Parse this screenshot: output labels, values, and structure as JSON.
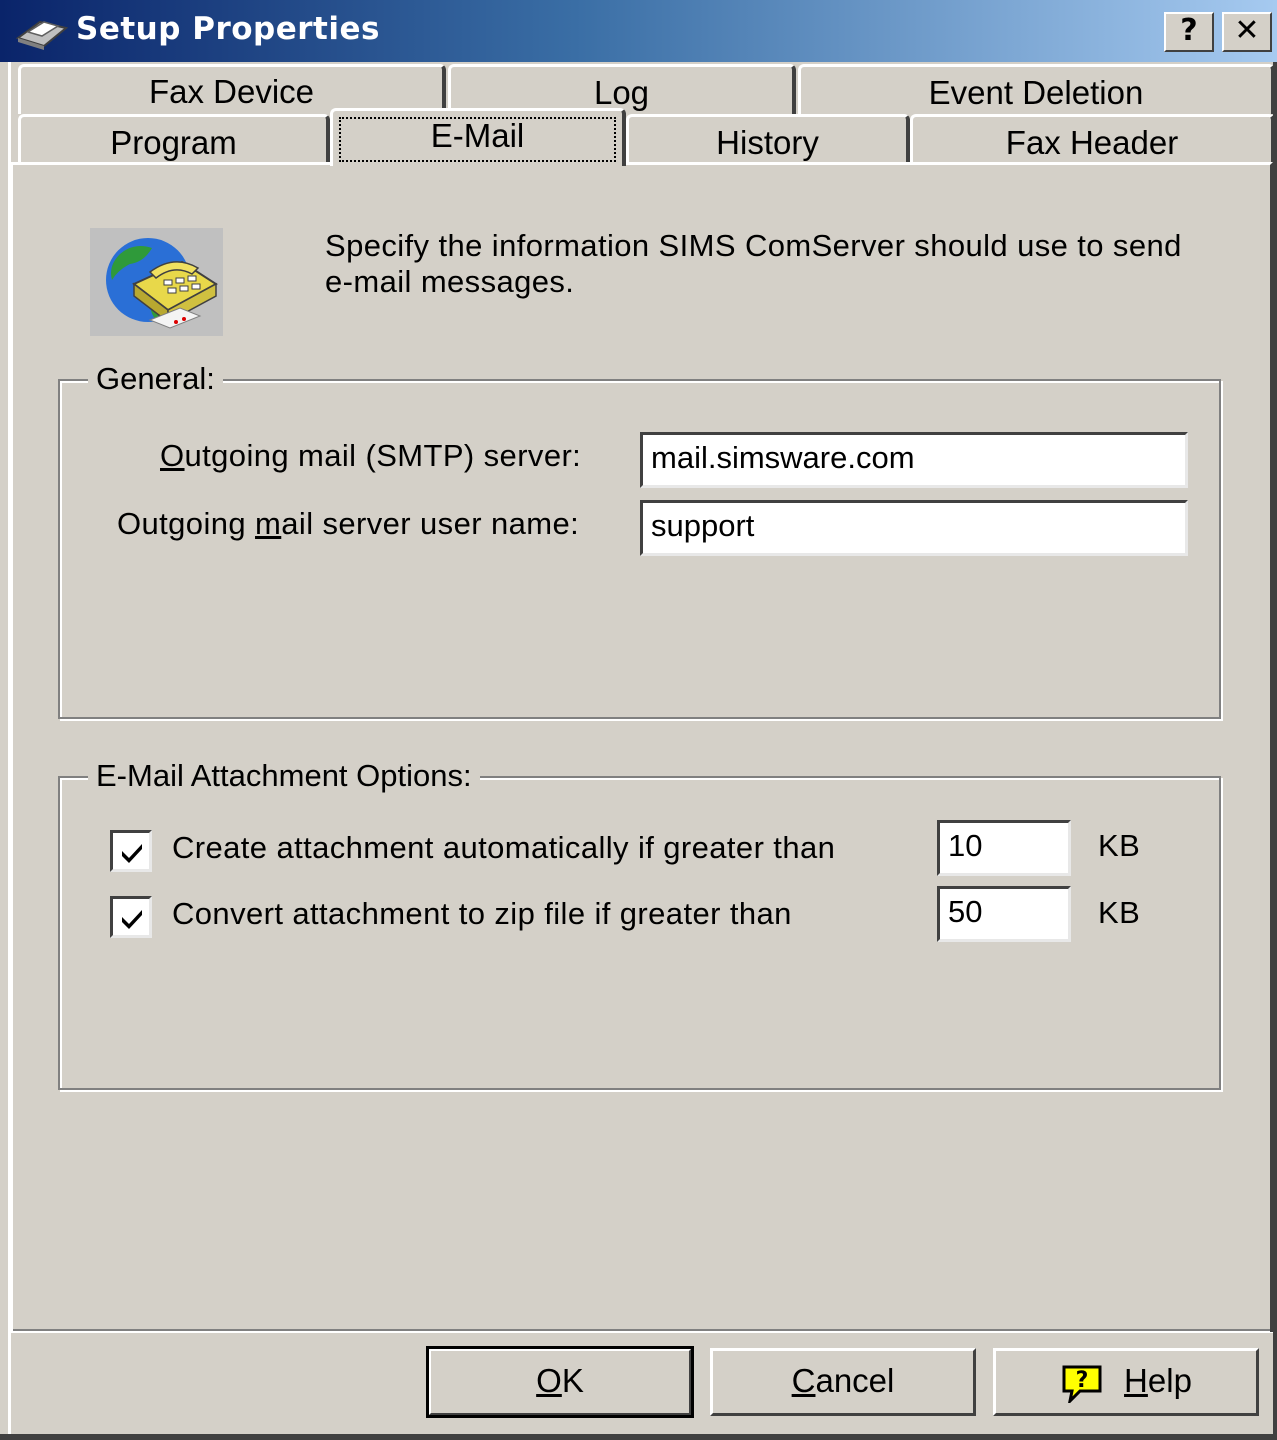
{
  "window": {
    "title": "Setup Properties",
    "help_button": "?",
    "close_button": "✕"
  },
  "tabs": {
    "row1": [
      "Fax Device",
      "Log",
      "Event Deletion"
    ],
    "row2": [
      "Program",
      "E-Mail",
      "History",
      "Fax Header"
    ],
    "active": "E-Mail"
  },
  "intro": {
    "text": "Specify the information SIMS ComServer should use to send e-mail messages."
  },
  "general": {
    "legend": "General:",
    "smtp_label_pre": "",
    "smtp_label_u": "O",
    "smtp_label_post": "utgoing mail (SMTP) server:",
    "smtp_value": "mail.simsware.com",
    "user_label_pre": "Outgoing ",
    "user_label_u": "m",
    "user_label_post": "ail server user name:",
    "user_value": "support"
  },
  "attachments": {
    "legend": "E-Mail Attachment Options:",
    "create_label": "Create attachment automatically if greater than",
    "create_checked": true,
    "create_value": "10",
    "create_unit": "KB",
    "zip_label": "Convert attachment to zip file if greater than",
    "zip_checked": true,
    "zip_value": "50",
    "zip_unit": "KB"
  },
  "buttons": {
    "ok_u": "O",
    "ok_rest": "K",
    "cancel_u": "C",
    "cancel_rest": "ancel",
    "help_u": "H",
    "help_rest": "elp"
  }
}
